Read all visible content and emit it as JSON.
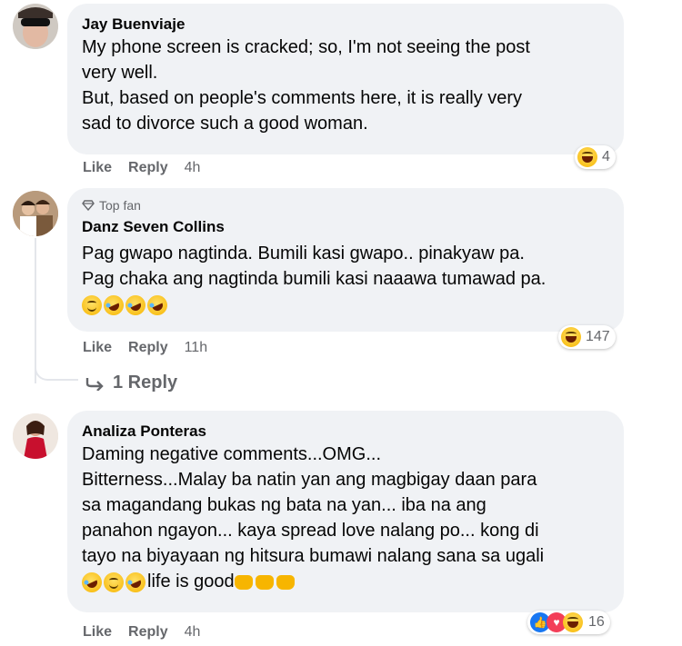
{
  "comments": [
    {
      "author": "Jay Buenviaje",
      "lines": [
        "My phone screen is cracked; so, I'm not seeing the post",
        "very well.",
        "But, based on people's comments here, it is really very",
        "sad to divorce such a good woman."
      ],
      "like": "Like",
      "reply": "Reply",
      "time": "4h",
      "reaction_count": "4"
    },
    {
      "badge": "Top fan",
      "author": "Danz Seven Collins",
      "lines": [
        "Pag gwapo nagtinda. Bumili kasi gwapo.. pinakyaw pa.",
        "Pag chaka ang nagtinda bumili kasi naaawa tumawad pa."
      ],
      "like": "Like",
      "reply": "Reply",
      "time": "11h",
      "reaction_count": "147",
      "replies_link": "1 Reply"
    },
    {
      "author": "Analiza Ponteras",
      "lines": [
        "Daming negative comments...OMG...",
        "Bitterness...Malay ba natin yan ang magbigay daan para",
        "sa magandang bukas ng bata na yan... iba na ang",
        "panahon ngayon... kaya spread love nalang po... kong di",
        "tayo na biyayaan ng hitsura bumawi nalang sana sa ugali"
      ],
      "last_line_text": "life is good",
      "like": "Like",
      "reply": "Reply",
      "time": "4h",
      "reaction_count": "16"
    }
  ],
  "colors": {
    "bubble": "#f0f2f5",
    "meta": "#65676b",
    "text": "#050505"
  }
}
